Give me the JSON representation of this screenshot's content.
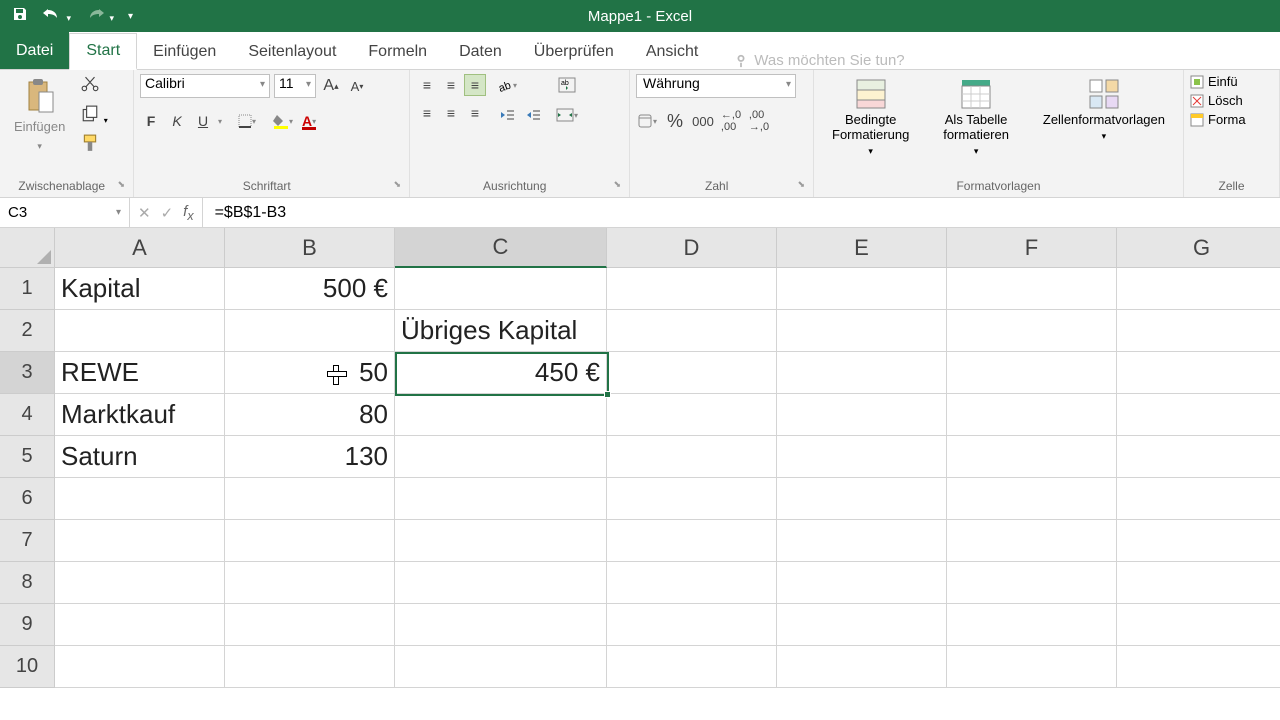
{
  "title": "Mappe1 - Excel",
  "tabs": {
    "file": "Datei",
    "home": "Start",
    "insert": "Einfügen",
    "pagelayout": "Seitenlayout",
    "formulas": "Formeln",
    "data": "Daten",
    "review": "Überprüfen",
    "view": "Ansicht",
    "tellme": "Was möchten Sie tun?"
  },
  "ribbon": {
    "paste": "Einfügen",
    "clipboard": "Zwischenablage",
    "font_name": "Calibri",
    "font_size": "11",
    "font": "Schriftart",
    "alignment": "Ausrichtung",
    "number_format": "Währung",
    "number": "Zahl",
    "cond_format": "Bedingte Formatierung",
    "as_table": "Als Tabelle formatieren",
    "cell_styles": "Zellenformatvorlagen",
    "styles": "Formatvorlagen",
    "insert_cells": "Einfü",
    "delete_cells": "Lösch",
    "format_cells": "Forma",
    "cells": "Zelle"
  },
  "namebox": "C3",
  "formula": "=$B$1-B3",
  "cols": [
    "A",
    "B",
    "C",
    "D",
    "E",
    "F",
    "G"
  ],
  "rows": {
    "r1": {
      "a": "Kapital",
      "b": "500 €"
    },
    "r2": {
      "c": "Übriges Kapital"
    },
    "r3": {
      "a": "REWE",
      "b": "50",
      "c": "450 €"
    },
    "r4": {
      "a": "Marktkauf",
      "b": "80"
    },
    "r5": {
      "a": "Saturn",
      "b": "130"
    }
  }
}
